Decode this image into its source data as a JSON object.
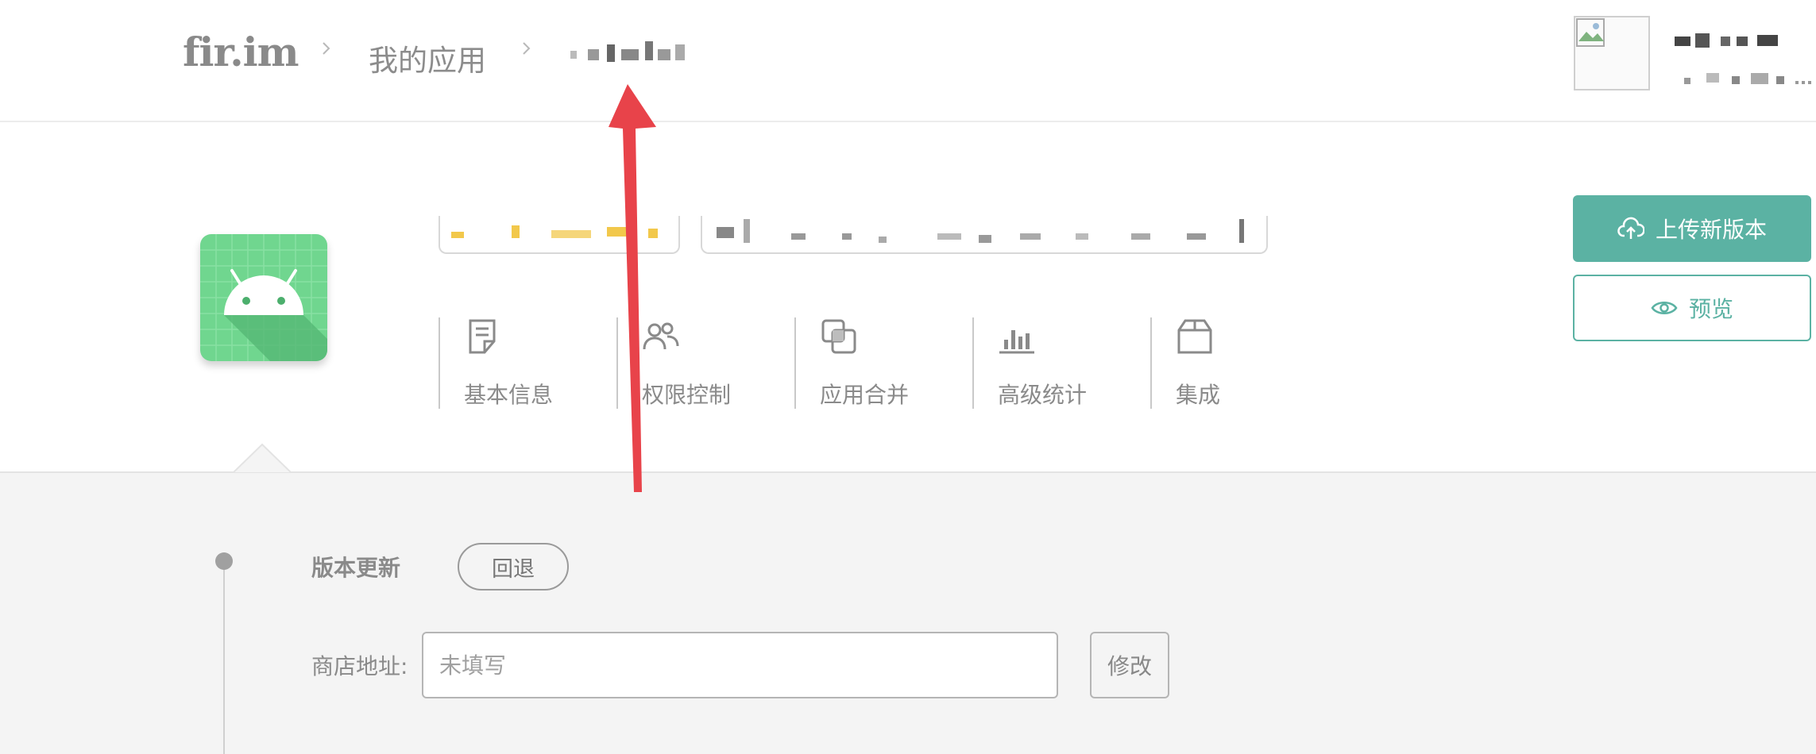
{
  "brand": {
    "logo": "fir.im"
  },
  "breadcrumb": {
    "items": [
      {
        "label": "我的应用"
      }
    ]
  },
  "app": {
    "nav": [
      {
        "label": "基本信息",
        "icon": "document-icon"
      },
      {
        "label": "权限控制",
        "icon": "users-icon"
      },
      {
        "label": "应用合并",
        "icon": "merge-icon"
      },
      {
        "label": "高级统计",
        "icon": "bar-chart-icon"
      },
      {
        "label": "集成",
        "icon": "box-icon"
      }
    ]
  },
  "actions": {
    "upload_label": "上传新版本",
    "preview_label": "预览"
  },
  "version": {
    "section_title": "版本更新",
    "rollback_label": "回退",
    "store_label": "商店地址:",
    "store_placeholder": "未填写",
    "edit_label": "修改"
  },
  "colors": {
    "accent": "#5bb2a3",
    "android_green": "#70d68f",
    "annotation_arrow": "#e8434a"
  }
}
